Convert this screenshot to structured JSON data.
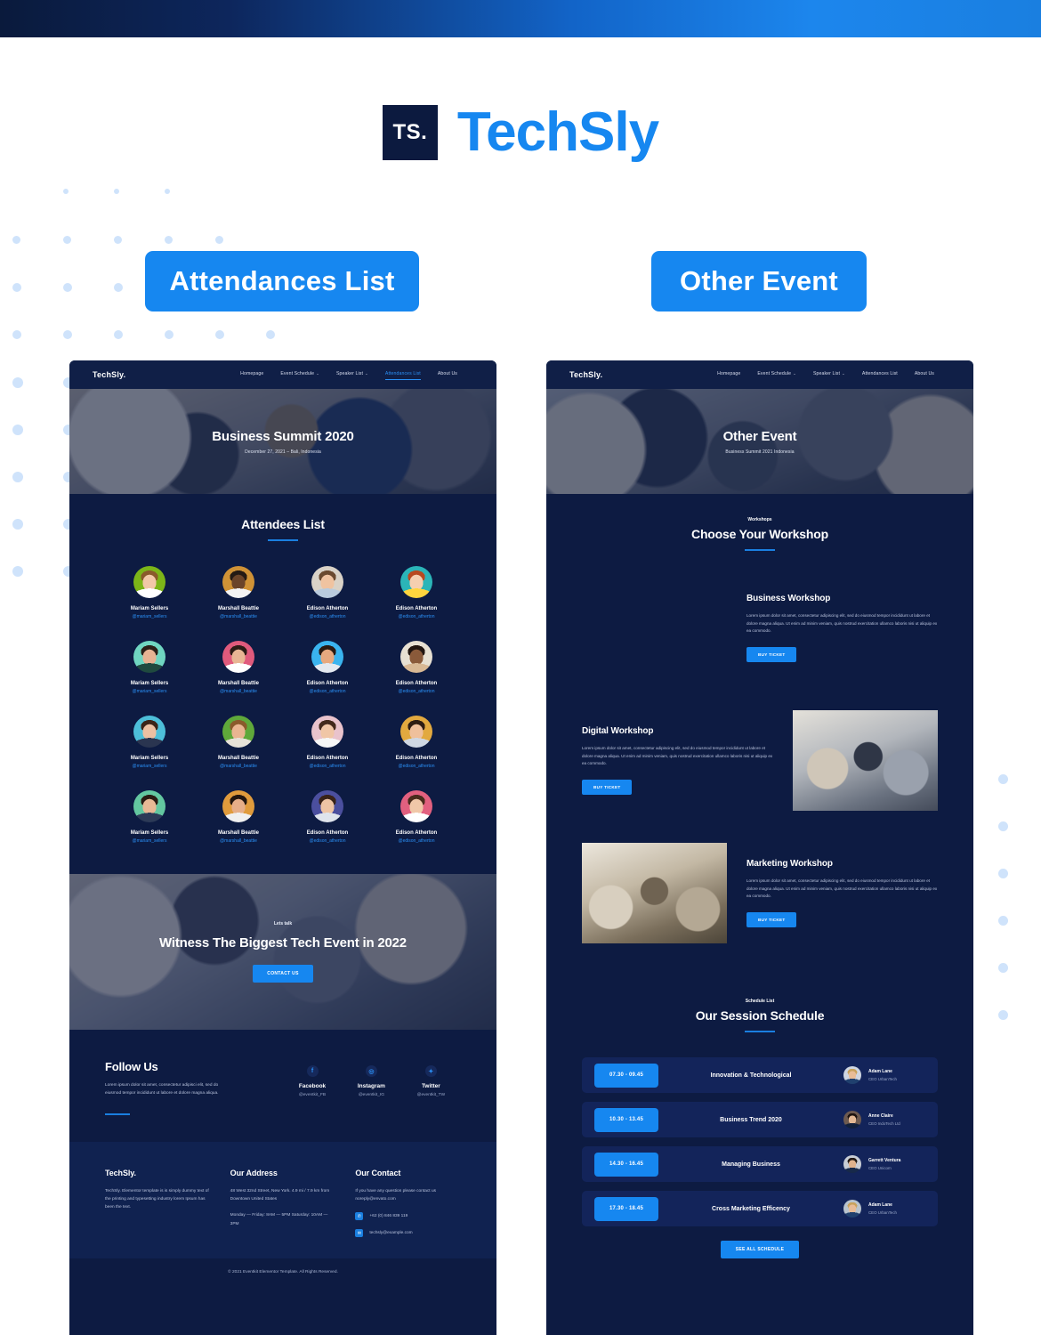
{
  "brand": {
    "mark": "TS.",
    "name": "TechSly"
  },
  "pills": {
    "left": "Attendances List",
    "right": "Other Event"
  },
  "colors": {
    "accent": "#1687f0",
    "dark_navy": "#0d1b42",
    "nav_navy": "#101f47",
    "dot": "#cfe3fb"
  },
  "left_mock": {
    "nav": {
      "logo": "TechSly.",
      "items": [
        {
          "label": "Homepage",
          "caret": false,
          "active": false
        },
        {
          "label": "Event Schedule",
          "caret": true,
          "active": false
        },
        {
          "label": "Speaker List",
          "caret": true,
          "active": false
        },
        {
          "label": "Attendances List",
          "caret": false,
          "active": true
        },
        {
          "label": "About Us",
          "caret": false,
          "active": false
        }
      ]
    },
    "hero": {
      "title": "Business Summit 2020",
      "subtitle": "December 27, 2021 – Bali, Indonesia"
    },
    "attendees_section": {
      "title": "Attendees List"
    },
    "attendees": [
      {
        "name": "Mariam Sellers",
        "handle": "@mariam_sellers",
        "bg": "#7cb518",
        "skin": "#f2c8a8",
        "hair": "#8a5a2b",
        "shirt": "#ffffff"
      },
      {
        "name": "Marshall Beattie",
        "handle": "@marshall_beattie",
        "bg": "#cf9236",
        "skin": "#6b4429",
        "hair": "#241a14",
        "shirt": "#f4f4f4"
      },
      {
        "name": "Edison Atherton",
        "handle": "@edison_atherton",
        "bg": "#d9d2c7",
        "skin": "#f0c3a0",
        "hair": "#6b4a2f",
        "shirt": "#b9cbdd"
      },
      {
        "name": "Edison Atherton",
        "handle": "@edison_atherton",
        "bg": "#2bb5b8",
        "skin": "#f5cfb0",
        "hair": "#b8491f",
        "shirt": "#ffd53e"
      },
      {
        "name": "Mariam Sellers",
        "handle": "@mariam_sellers",
        "bg": "#6fd6c1",
        "skin": "#e7b393",
        "hair": "#2b2018",
        "shirt": "#1f4a3f"
      },
      {
        "name": "Marshall Beattie",
        "handle": "@marshall_beattie",
        "bg": "#e05a7c",
        "skin": "#e8b694",
        "hair": "#2d1c16",
        "shirt": "#ffffff"
      },
      {
        "name": "Edison Atherton",
        "handle": "@edison_atherton",
        "bg": "#3ab4ef",
        "skin": "#e7a97f",
        "hair": "#2a1a12",
        "shirt": "#e3e9f0"
      },
      {
        "name": "Edison Atherton",
        "handle": "@edison_atherton",
        "bg": "#e7e0d2",
        "skin": "#8a5a3a",
        "hair": "#221610",
        "shirt": "#d8b894"
      },
      {
        "name": "Mariam Sellers",
        "handle": "@mariam_sellers",
        "bg": "#4dbfd9",
        "skin": "#ecc0a2",
        "hair": "#3b2418",
        "shirt": "#2a3550"
      },
      {
        "name": "Marshall Beattie",
        "handle": "@marshall_beattie",
        "bg": "#5fa83a",
        "skin": "#e9b591",
        "hair": "#8a5a2b",
        "shirt": "#e7e2d8"
      },
      {
        "name": "Edison Atherton",
        "handle": "@edison_atherton",
        "bg": "#e9c3cc",
        "skin": "#f0c6a6",
        "hair": "#43291b",
        "shirt": "#f6f6f6"
      },
      {
        "name": "Edison Atherton",
        "handle": "@edison_atherton",
        "bg": "#e2a93f",
        "skin": "#efc09c",
        "hair": "#2e1d13",
        "shirt": "#cfd7e2"
      },
      {
        "name": "Mariam Sellers",
        "handle": "@mariam_sellers",
        "bg": "#63c7a0",
        "skin": "#e8b995",
        "hair": "#2a1b12",
        "shirt": "#2c3a57"
      },
      {
        "name": "Marshall Beattie",
        "handle": "@marshall_beattie",
        "bg": "#e09b3c",
        "skin": "#e6ae88",
        "hair": "#231710",
        "shirt": "#f0f0f0"
      },
      {
        "name": "Edison Atherton",
        "handle": "@edison_atherton",
        "bg": "#4b4f9e",
        "skin": "#eec4a4",
        "hair": "#392318",
        "shirt": "#dfe4ec"
      },
      {
        "name": "Edison Atherton",
        "handle": "@edison_atherton",
        "bg": "#e2607f",
        "skin": "#f0c7a8",
        "hair": "#4a2c1c",
        "shirt": "#ffffff"
      }
    ],
    "cta": {
      "eyebrow": "Lets talk",
      "title": "Witness The Biggest Tech Event in 2022",
      "button": "CONTACT US"
    },
    "follow": {
      "title": "Follow Us",
      "text": "Lorem ipsum dolor sit amet, consectetur adipisci elit, sed do eiusmod tempor incididunt ut labore et dolore magna aliqua.",
      "socials": [
        {
          "icon": "facebook-icon",
          "glyph": "f",
          "name": "Facebook",
          "handle": "@eventkit_FB"
        },
        {
          "icon": "instagram-icon",
          "glyph": "◎",
          "name": "Instagram",
          "handle": "@eventkit_IG"
        },
        {
          "icon": "twitter-icon",
          "glyph": "✦",
          "name": "Twitter",
          "handle": "@eventkit_TW"
        }
      ]
    },
    "footer": {
      "brand_title": "TechSly.",
      "brand_text": "TechSly. Elementor template is is simply dummy text of the printing and typesetting industry lorem Ipsum has been the text.",
      "address_title": "Our Address",
      "address_line1": "48 West 32nd Street, New York. 4.9 mi / 7.9 km from Downtown United States",
      "address_line2": "Monday — Friday: 8AM — 5PM Saturday: 10AM — 3PM",
      "contact_title": "Our Contact",
      "contact_text": "If you have any question please contact us noreply@envato.com",
      "phone": "+62 (0) 846 839 119",
      "email": "techsly@example.com",
      "copyright": "© 2021 Eventkit Elementor Template. All Rights Reserved."
    }
  },
  "right_mock": {
    "nav": {
      "logo": "TechSly.",
      "items": [
        {
          "label": "Homepage",
          "caret": false,
          "active": false
        },
        {
          "label": "Event Schedule",
          "caret": true,
          "active": false
        },
        {
          "label": "Speaker List",
          "caret": true,
          "active": false
        },
        {
          "label": "Attendances List",
          "caret": false,
          "active": false
        },
        {
          "label": "About Us",
          "caret": false,
          "active": false
        }
      ]
    },
    "hero": {
      "title": "Other Event",
      "subtitle": "Business Summit 2021 Indonesia"
    },
    "workshop_section": {
      "eyebrow": "Workshops",
      "title": "Choose Your Workshop"
    },
    "workshops": [
      {
        "title": "Business Workshop",
        "text": "Lorem ipsum dolor sit amet, consectetur adipiscing elit, sed do eiusmod tempor incididunt ut labore et dolore magna aliqua. Ut enim ad minim veniam, quis nostrud exercitation ullamco laboris nisi ut aliquip ex ea commodo.",
        "button": "BUY TICKET",
        "image_side": "left"
      },
      {
        "title": "Digital Workshop",
        "text": "Lorem ipsum dolor sit amet, consectetur adipiscing elit, sed do eiusmod tempor incididunt ut labore et dolore magna aliqua. Ut enim ad minim veniam, quis nostrud exercitation ullamco laboris nisi ut aliquip ex ea commodo.",
        "button": "BUY TICKET",
        "image_side": "right"
      },
      {
        "title": "Marketing Workshop",
        "text": "Lorem ipsum dolor sit amet, consectetur adipiscing elit, sed do eiusmod tempor incididunt ut labore et dolore magna aliqua. Ut enim ad minim veniam, quis nostrud exercitation ullamco laboris nisi ut aliquip ex ea commodo.",
        "button": "BUY TICKET",
        "image_side": "left"
      }
    ],
    "schedule_section": {
      "eyebrow": "Schedule List",
      "title": "Our Session Schedule",
      "see_all": "SEE ALL SCHEDULE"
    },
    "schedule": [
      {
        "time": "07.30 - 09.45",
        "topic": "Innovation & Technological",
        "name": "Adam Lane",
        "role": "CEO UrbanTech"
      },
      {
        "time": "10.30 - 13.45",
        "topic": "Business Trend 2020",
        "name": "Anne Claire",
        "role": "CEO IndoTech Ltd"
      },
      {
        "time": "14.30 - 16.45",
        "topic": "Managing Business",
        "name": "Garrett Ventura",
        "role": "CEO Unicorn"
      },
      {
        "time": "17.30 - 18.45",
        "topic": "Cross Marketing Efficency",
        "name": "Adam Lane",
        "role": "CEO UrbanTech"
      }
    ]
  }
}
